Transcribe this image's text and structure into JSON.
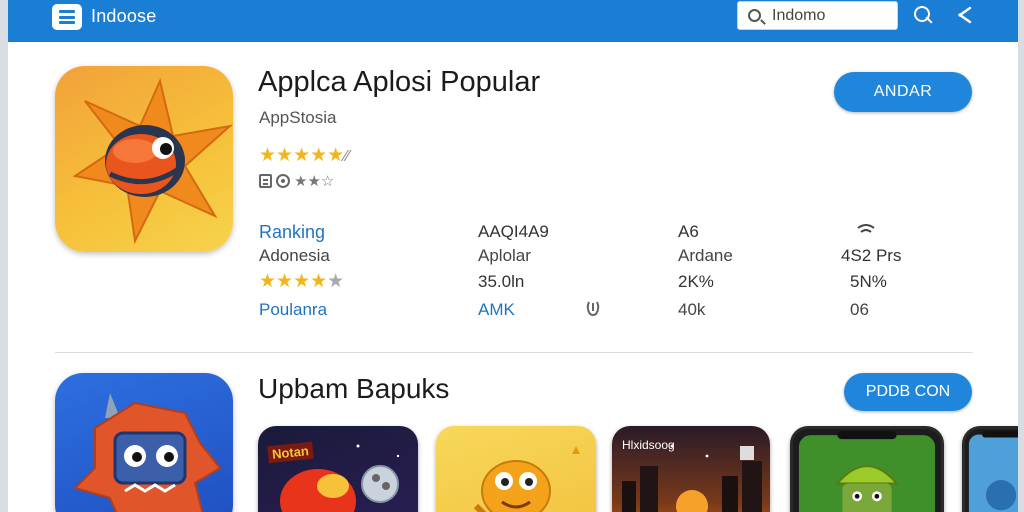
{
  "header": {
    "brand": "Indoose",
    "search_placeholder": "Indomo",
    "bar_color": "#1a7fd4"
  },
  "app": {
    "title": "Applca Aplosi Popular",
    "developer": "AppStosia",
    "rating_stars": "★★★★★",
    "rating_suffix": "⁄⁄",
    "action_label": "ANDAR"
  },
  "stats": {
    "col1": {
      "header": "Ranking",
      "sub": "Adonesia",
      "stars": "★★★★",
      "stars_dim": "★",
      "footer": "Poulanra"
    },
    "col2": {
      "header": "AAQI4A9",
      "sub": "Aplolar",
      "value": "35.0ln",
      "footer": "AMK"
    },
    "col3": {
      "header": "A6",
      "sub": "Ardane",
      "value": "2K%",
      "footer": "40k"
    },
    "col4": {
      "sub": "4S2 Prs",
      "value": "5N%",
      "footer": "06"
    }
  },
  "section": {
    "title": "Upbam Bapuks",
    "action_label": "PDDB CON"
  },
  "thumbnails": [
    {
      "name": "thumb-1",
      "label": "Notan"
    },
    {
      "name": "thumb-2",
      "label": ""
    },
    {
      "name": "thumb-3",
      "label": "Hlxidsoog"
    },
    {
      "name": "thumb-4",
      "label": ""
    },
    {
      "name": "thumb-5",
      "label": ""
    }
  ],
  "colors": {
    "accent": "#1f86db",
    "link": "#1f74c4",
    "star": "#f2b61d"
  },
  "icons": [
    "menu-icon",
    "search-icon",
    "share-icon",
    "wifi-icon",
    "clip-icon"
  ]
}
